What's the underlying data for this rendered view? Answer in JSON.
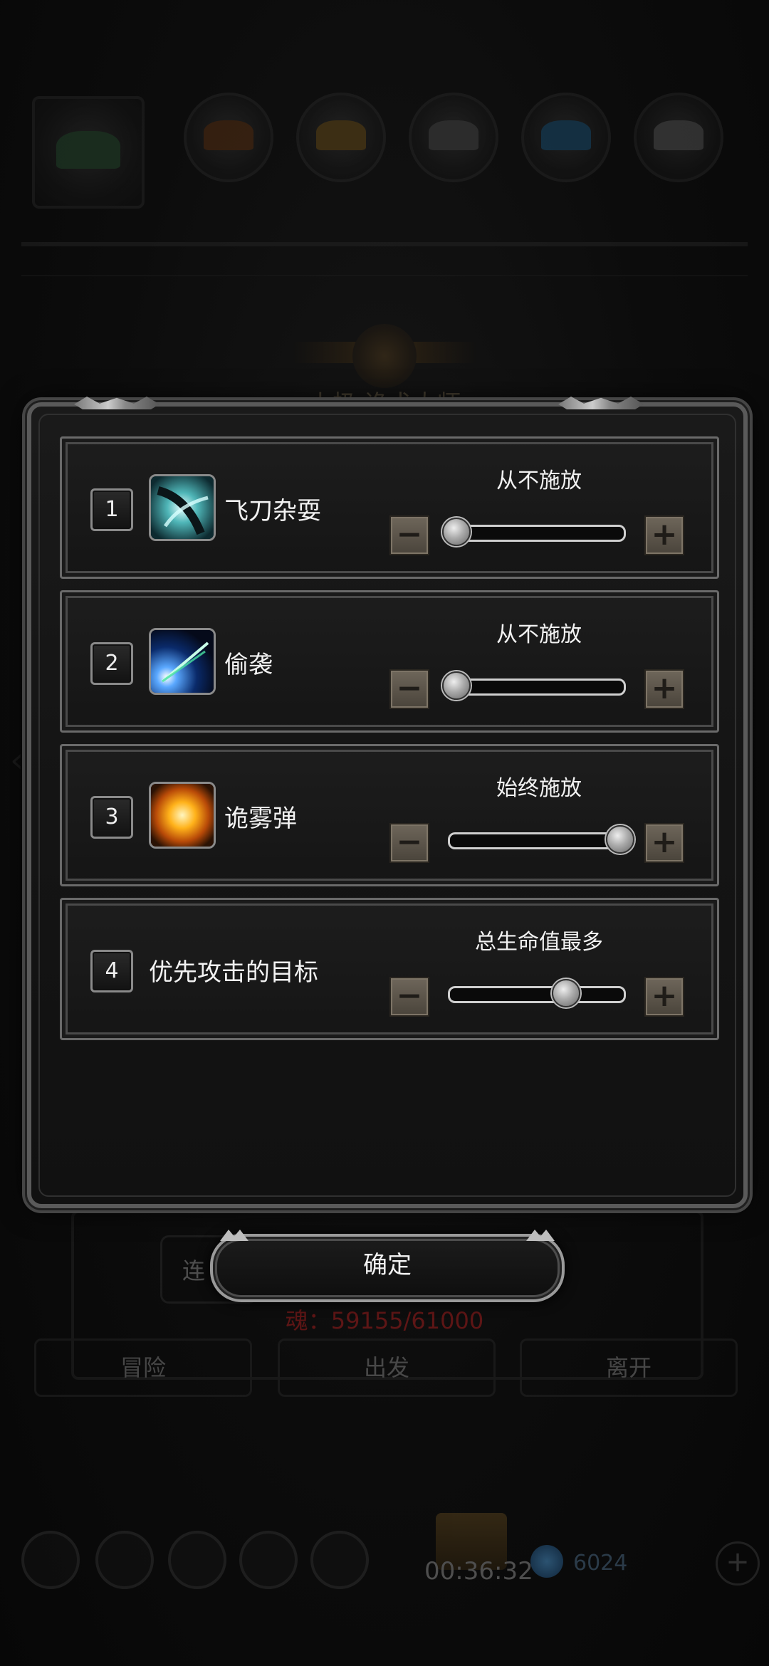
{
  "background": {
    "title": "小极 诡术大师",
    "left_button_label": "连",
    "soul_text": "魂：59155/61000",
    "bottom_buttons": [
      "冒险",
      "出发",
      "离开"
    ],
    "timer": "00:36:32",
    "gem_count": "6024",
    "plus_label": "+"
  },
  "modal": {
    "confirm_label": "确定",
    "minus_symbol": "−",
    "plus_symbol": "+",
    "rows": [
      {
        "index": "1",
        "name": "飞刀杂耍",
        "mode": "从不施放",
        "level": 0.0,
        "icon": "flying-knife-skill-icon"
      },
      {
        "index": "2",
        "name": "偷袭",
        "mode": "从不施放",
        "level": 0.0,
        "icon": "sneak-attack-skill-icon"
      },
      {
        "index": "3",
        "name": "诡雾弹",
        "mode": "始终施放",
        "level": 1.0,
        "icon": "mist-bomb-skill-icon"
      },
      {
        "index": "4",
        "name": "优先攻击的目标",
        "mode": "总生命值最多",
        "level": 0.67,
        "icon": ""
      }
    ]
  },
  "colors": {
    "panel_border": "#6a6a6a",
    "step_button": "#5c564c",
    "soul_text": "#cc2222"
  }
}
